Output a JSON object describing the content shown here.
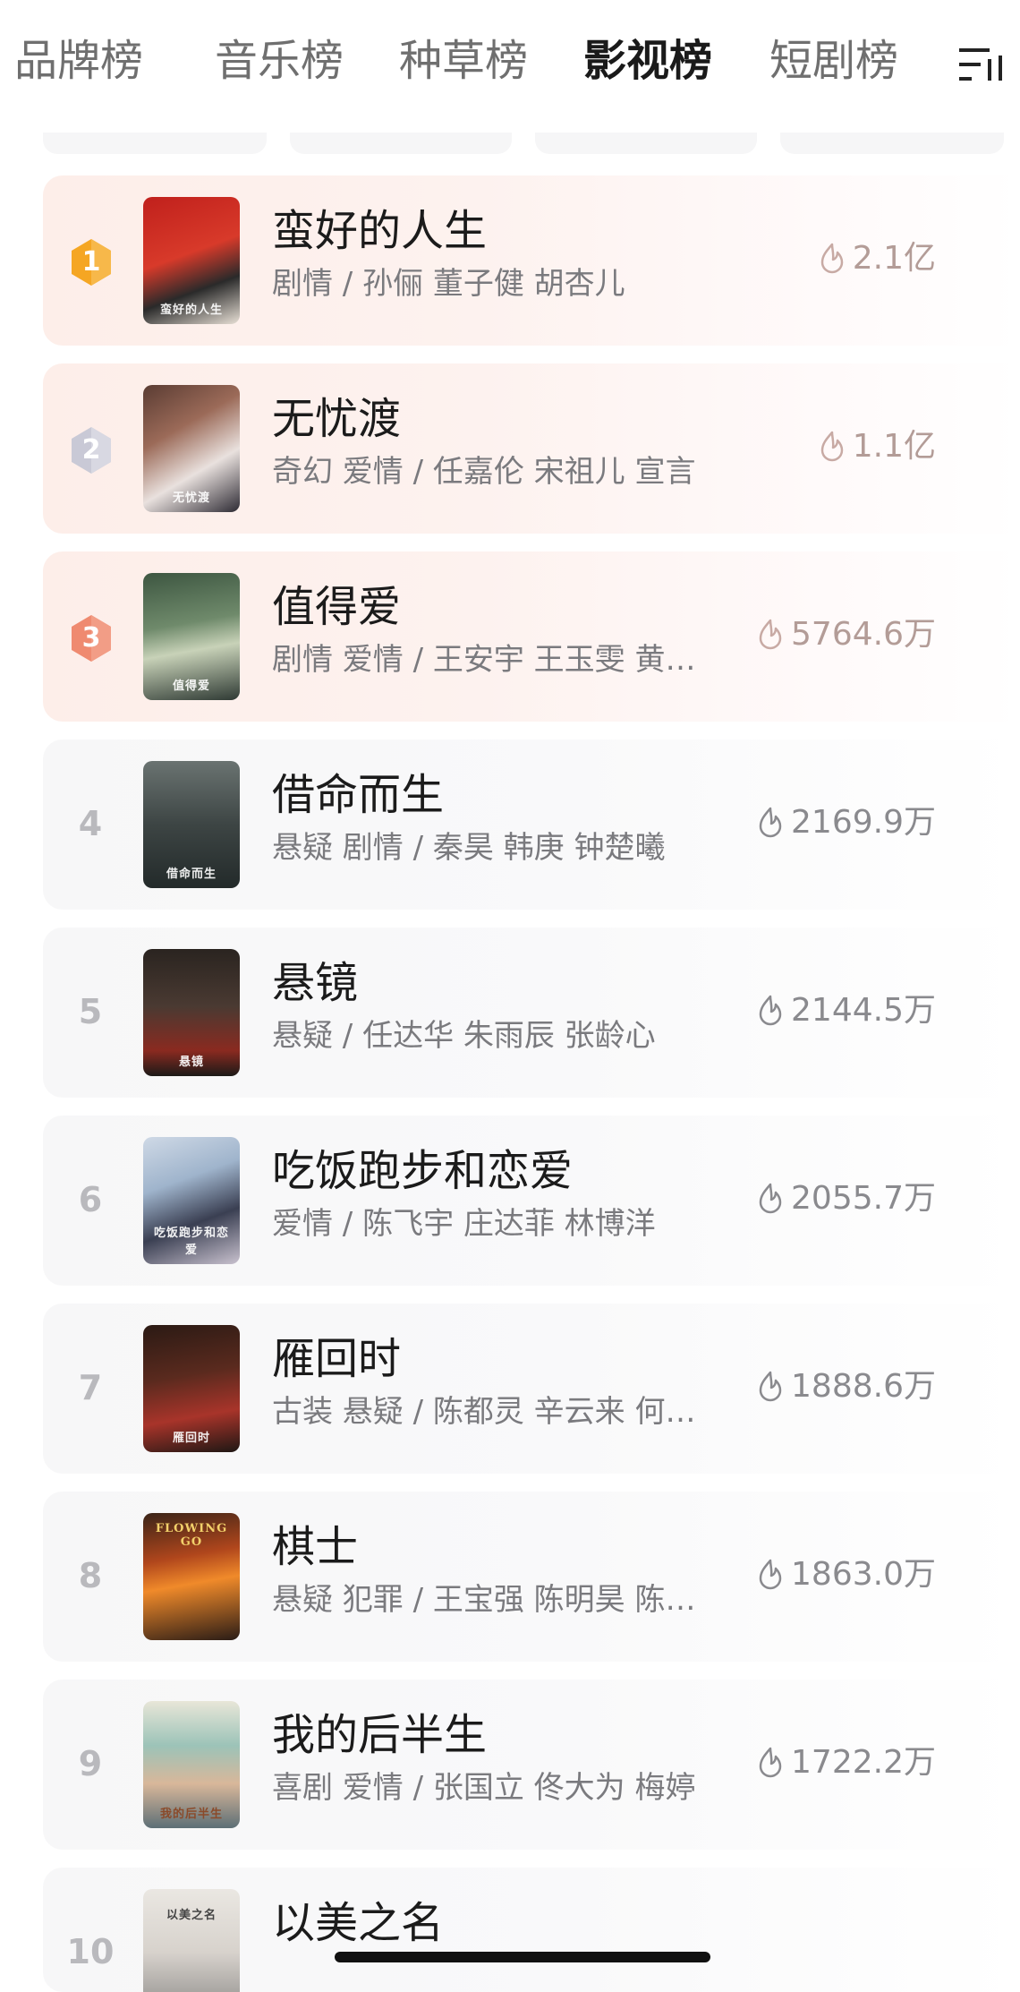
{
  "tabs": [
    {
      "label": "品牌榜",
      "active": false
    },
    {
      "label": "音乐榜",
      "active": false
    },
    {
      "label": "种草榜",
      "active": false
    },
    {
      "label": "影视榜",
      "active": true
    },
    {
      "label": "短剧榜",
      "active": false
    }
  ],
  "menu_icon": "filter-list-icon",
  "colors": {
    "gold_medal": "#f5a623",
    "silver_medal": "#c9c9d6",
    "bronze_medal": "#ef8a70",
    "heat_icon_top": "#c8aaa4",
    "heat_icon": "#8a8a8e"
  },
  "rankings": [
    {
      "rank": "1",
      "title": "蛮好的人生",
      "sub": "剧情 / 孙俪 董子健 胡杏儿",
      "heat": "2.1亿",
      "poster_caption": "蛮好的人生"
    },
    {
      "rank": "2",
      "title": "无忧渡",
      "sub": "奇幻 爱情 / 任嘉伦 宋祖儿 宣言",
      "heat": "1.1亿",
      "poster_caption": "无忧渡"
    },
    {
      "rank": "3",
      "title": "值得爱",
      "sub": "剧情 爱情 / 王安宇 王玉雯 黄…",
      "heat": "5764.6万",
      "poster_caption": "值得爱"
    },
    {
      "rank": "4",
      "title": "借命而生",
      "sub": "悬疑 剧情 / 秦昊 韩庚 钟楚曦",
      "heat": "2169.9万",
      "poster_caption": "借命而生"
    },
    {
      "rank": "5",
      "title": "悬镜",
      "sub": "悬疑 / 任达华 朱雨辰 张龄心",
      "heat": "2144.5万",
      "poster_caption": "悬镜"
    },
    {
      "rank": "6",
      "title": "吃饭跑步和恋爱",
      "sub": "爱情 / 陈飞宇 庄达菲 林博洋",
      "heat": "2055.7万",
      "poster_caption": "吃饭跑步和恋爱"
    },
    {
      "rank": "7",
      "title": "雁回时",
      "sub": "古装 悬疑 / 陈都灵 辛云来 何…",
      "heat": "1888.6万",
      "poster_caption": "雁回时"
    },
    {
      "rank": "8",
      "title": "棋士",
      "sub": "悬疑 犯罪 / 王宝强 陈明昊 陈…",
      "heat": "1863.0万",
      "poster_caption": "FLOWING GO"
    },
    {
      "rank": "9",
      "title": "我的后半生",
      "sub": "喜剧 爱情 / 张国立 佟大为 梅婷",
      "heat": "1722.2万",
      "poster_caption": "我的后半生"
    },
    {
      "rank": "10",
      "title": "以美之名",
      "sub": "",
      "heat": "",
      "poster_caption": "以美之名"
    }
  ]
}
